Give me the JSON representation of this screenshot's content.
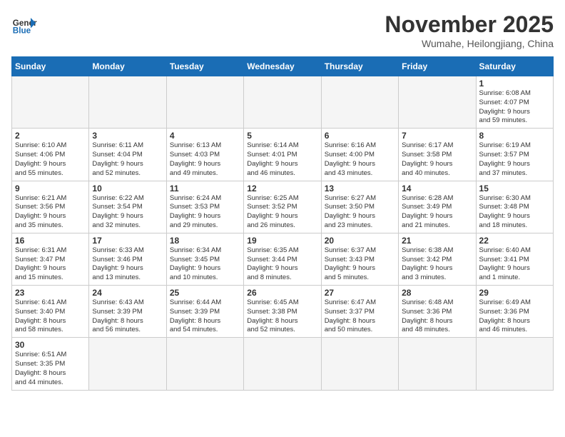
{
  "header": {
    "logo_general": "General",
    "logo_blue": "Blue",
    "month": "November 2025",
    "location": "Wumahe, Heilongjiang, China"
  },
  "weekdays": [
    "Sunday",
    "Monday",
    "Tuesday",
    "Wednesday",
    "Thursday",
    "Friday",
    "Saturday"
  ],
  "weeks": [
    [
      {
        "day": "",
        "info": ""
      },
      {
        "day": "",
        "info": ""
      },
      {
        "day": "",
        "info": ""
      },
      {
        "day": "",
        "info": ""
      },
      {
        "day": "",
        "info": ""
      },
      {
        "day": "",
        "info": ""
      },
      {
        "day": "1",
        "info": "Sunrise: 6:08 AM\nSunset: 4:07 PM\nDaylight: 9 hours\nand 59 minutes."
      }
    ],
    [
      {
        "day": "2",
        "info": "Sunrise: 6:10 AM\nSunset: 4:06 PM\nDaylight: 9 hours\nand 55 minutes."
      },
      {
        "day": "3",
        "info": "Sunrise: 6:11 AM\nSunset: 4:04 PM\nDaylight: 9 hours\nand 52 minutes."
      },
      {
        "day": "4",
        "info": "Sunrise: 6:13 AM\nSunset: 4:03 PM\nDaylight: 9 hours\nand 49 minutes."
      },
      {
        "day": "5",
        "info": "Sunrise: 6:14 AM\nSunset: 4:01 PM\nDaylight: 9 hours\nand 46 minutes."
      },
      {
        "day": "6",
        "info": "Sunrise: 6:16 AM\nSunset: 4:00 PM\nDaylight: 9 hours\nand 43 minutes."
      },
      {
        "day": "7",
        "info": "Sunrise: 6:17 AM\nSunset: 3:58 PM\nDaylight: 9 hours\nand 40 minutes."
      },
      {
        "day": "8",
        "info": "Sunrise: 6:19 AM\nSunset: 3:57 PM\nDaylight: 9 hours\nand 37 minutes."
      }
    ],
    [
      {
        "day": "9",
        "info": "Sunrise: 6:21 AM\nSunset: 3:56 PM\nDaylight: 9 hours\nand 35 minutes."
      },
      {
        "day": "10",
        "info": "Sunrise: 6:22 AM\nSunset: 3:54 PM\nDaylight: 9 hours\nand 32 minutes."
      },
      {
        "day": "11",
        "info": "Sunrise: 6:24 AM\nSunset: 3:53 PM\nDaylight: 9 hours\nand 29 minutes."
      },
      {
        "day": "12",
        "info": "Sunrise: 6:25 AM\nSunset: 3:52 PM\nDaylight: 9 hours\nand 26 minutes."
      },
      {
        "day": "13",
        "info": "Sunrise: 6:27 AM\nSunset: 3:50 PM\nDaylight: 9 hours\nand 23 minutes."
      },
      {
        "day": "14",
        "info": "Sunrise: 6:28 AM\nSunset: 3:49 PM\nDaylight: 9 hours\nand 21 minutes."
      },
      {
        "day": "15",
        "info": "Sunrise: 6:30 AM\nSunset: 3:48 PM\nDaylight: 9 hours\nand 18 minutes."
      }
    ],
    [
      {
        "day": "16",
        "info": "Sunrise: 6:31 AM\nSunset: 3:47 PM\nDaylight: 9 hours\nand 15 minutes."
      },
      {
        "day": "17",
        "info": "Sunrise: 6:33 AM\nSunset: 3:46 PM\nDaylight: 9 hours\nand 13 minutes."
      },
      {
        "day": "18",
        "info": "Sunrise: 6:34 AM\nSunset: 3:45 PM\nDaylight: 9 hours\nand 10 minutes."
      },
      {
        "day": "19",
        "info": "Sunrise: 6:35 AM\nSunset: 3:44 PM\nDaylight: 9 hours\nand 8 minutes."
      },
      {
        "day": "20",
        "info": "Sunrise: 6:37 AM\nSunset: 3:43 PM\nDaylight: 9 hours\nand 5 minutes."
      },
      {
        "day": "21",
        "info": "Sunrise: 6:38 AM\nSunset: 3:42 PM\nDaylight: 9 hours\nand 3 minutes."
      },
      {
        "day": "22",
        "info": "Sunrise: 6:40 AM\nSunset: 3:41 PM\nDaylight: 9 hours\nand 1 minute."
      }
    ],
    [
      {
        "day": "23",
        "info": "Sunrise: 6:41 AM\nSunset: 3:40 PM\nDaylight: 8 hours\nand 58 minutes."
      },
      {
        "day": "24",
        "info": "Sunrise: 6:43 AM\nSunset: 3:39 PM\nDaylight: 8 hours\nand 56 minutes."
      },
      {
        "day": "25",
        "info": "Sunrise: 6:44 AM\nSunset: 3:39 PM\nDaylight: 8 hours\nand 54 minutes."
      },
      {
        "day": "26",
        "info": "Sunrise: 6:45 AM\nSunset: 3:38 PM\nDaylight: 8 hours\nand 52 minutes."
      },
      {
        "day": "27",
        "info": "Sunrise: 6:47 AM\nSunset: 3:37 PM\nDaylight: 8 hours\nand 50 minutes."
      },
      {
        "day": "28",
        "info": "Sunrise: 6:48 AM\nSunset: 3:36 PM\nDaylight: 8 hours\nand 48 minutes."
      },
      {
        "day": "29",
        "info": "Sunrise: 6:49 AM\nSunset: 3:36 PM\nDaylight: 8 hours\nand 46 minutes."
      }
    ],
    [
      {
        "day": "30",
        "info": "Sunrise: 6:51 AM\nSunset: 3:35 PM\nDaylight: 8 hours\nand 44 minutes."
      },
      {
        "day": "",
        "info": ""
      },
      {
        "day": "",
        "info": ""
      },
      {
        "day": "",
        "info": ""
      },
      {
        "day": "",
        "info": ""
      },
      {
        "day": "",
        "info": ""
      },
      {
        "day": "",
        "info": ""
      }
    ]
  ]
}
